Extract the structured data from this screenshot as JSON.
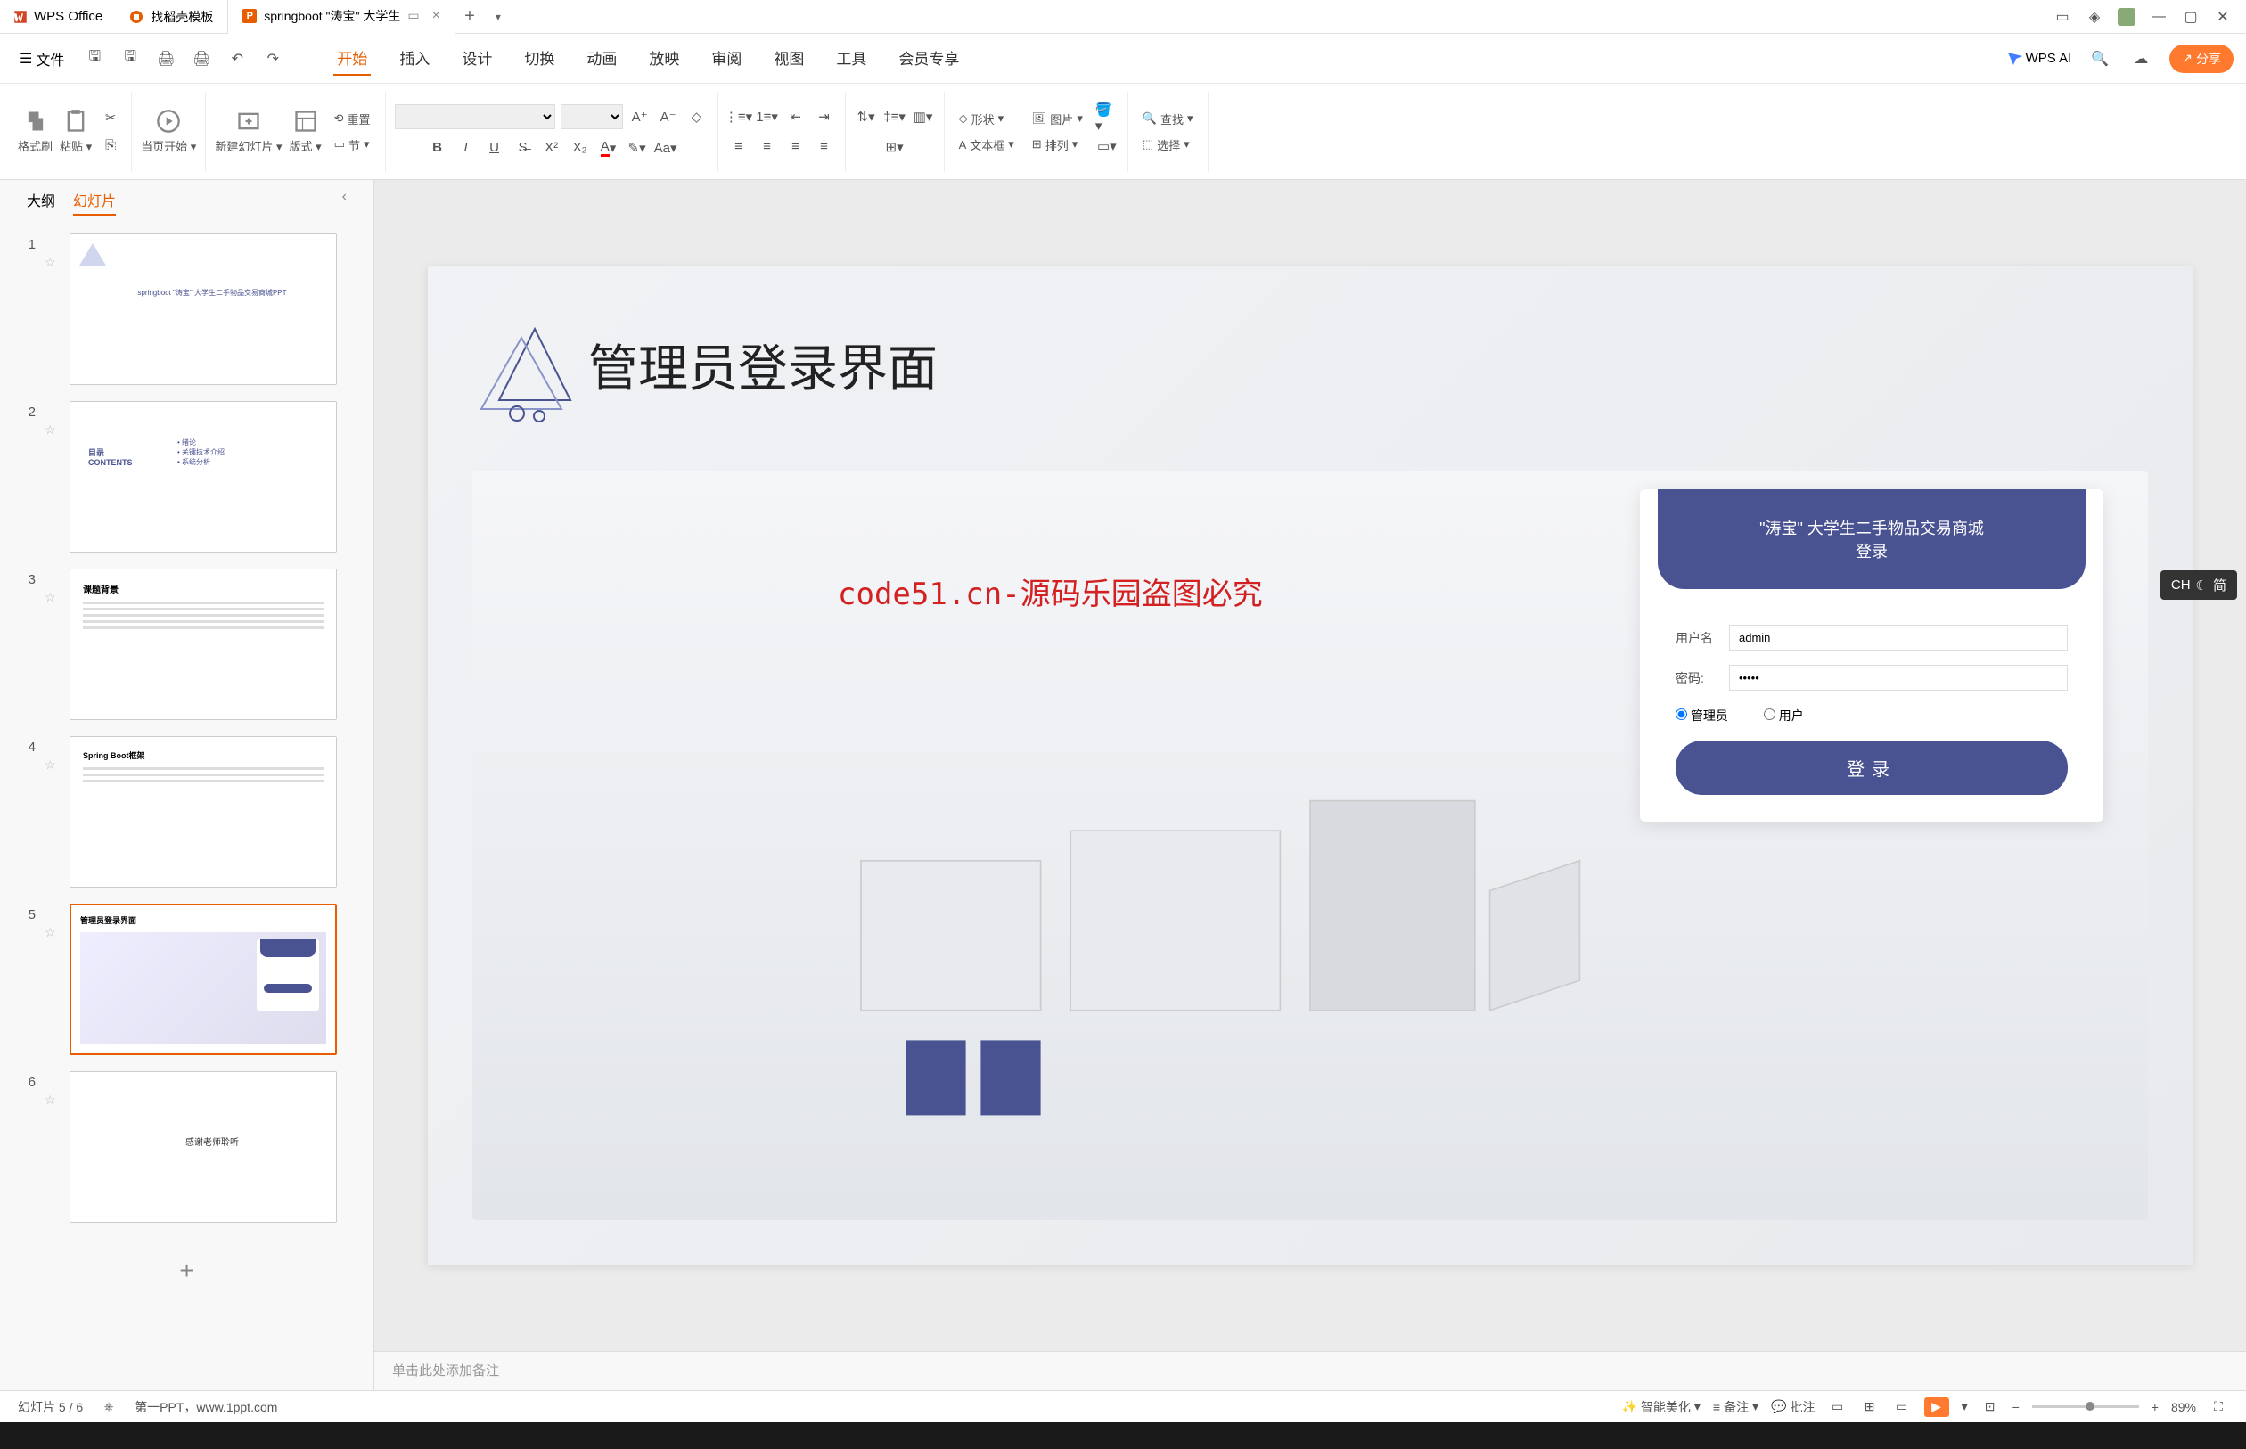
{
  "app": {
    "name": "WPS Office"
  },
  "tabs": {
    "template": "找稻壳模板",
    "doc": "springboot \"涛宝\" 大学生",
    "doc_icon": "P"
  },
  "menubar": {
    "file": "文件",
    "items": [
      "开始",
      "插入",
      "设计",
      "切换",
      "动画",
      "放映",
      "审阅",
      "视图",
      "工具",
      "会员专享"
    ],
    "active_index": 0,
    "wps_ai": "WPS AI",
    "share": "分享"
  },
  "ribbon": {
    "format_painter": "格式刷",
    "paste": "粘贴",
    "from_current": "当页开始",
    "new_slide": "新建幻灯片",
    "layout": "版式",
    "section": "节",
    "reset": "重置",
    "shape": "形状",
    "picture": "图片",
    "textbox": "文本框",
    "arrange": "排列",
    "find": "查找",
    "select": "选择"
  },
  "thumbpanel": {
    "outline": "大纲",
    "slides": "幻灯片"
  },
  "slides": [
    {
      "num": "1",
      "title": "springboot \"涛宝\" 大学生二手物品交易商城PPT"
    },
    {
      "num": "2",
      "title": "目录",
      "subtitle": "CONTENTS",
      "items": [
        "绪论",
        "关键技术介绍",
        "系统分析"
      ]
    },
    {
      "num": "3",
      "title": "课题背景"
    },
    {
      "num": "4",
      "title": "Spring Boot框架"
    },
    {
      "num": "5",
      "title": "管理员登录界面"
    },
    {
      "num": "6",
      "title": "感谢老师聆听"
    }
  ],
  "current_slide": {
    "title": "管理员登录界面",
    "red_watermark": "code51.cn-源码乐园盗图必究",
    "login": {
      "header": "\"涛宝\" 大学生二手物品交易商城",
      "header2": "登录",
      "user_label": "用户名",
      "user_value": "admin",
      "pass_label": "密码:",
      "pass_value": "•••••",
      "radio_admin": "管理员",
      "radio_user": "用户",
      "button": "登录"
    }
  },
  "notes": {
    "placeholder": "单击此处添加备注"
  },
  "statusbar": {
    "slide_counter": "幻灯片 5 / 6",
    "template_src": "第一PPT，www.1ppt.com",
    "smart_beautify": "智能美化",
    "notes": "备注",
    "comments": "批注",
    "zoom": "89%"
  },
  "ime": {
    "label": "CH",
    "mode": "简"
  },
  "watermark_text": "code51.cn"
}
